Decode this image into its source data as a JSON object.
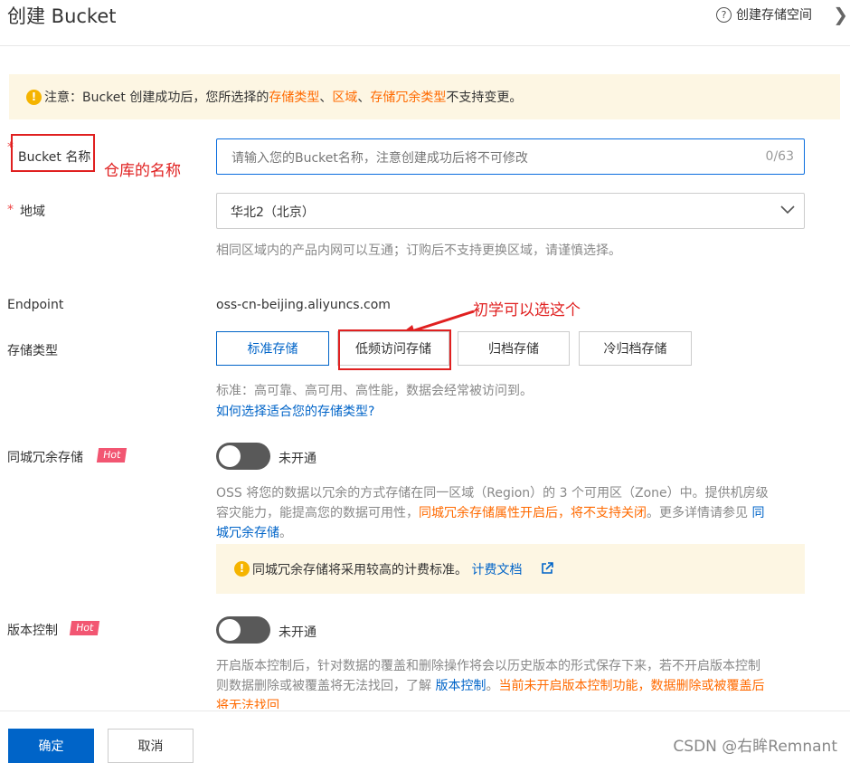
{
  "header": {
    "title": "创建 Bucket",
    "help_text": "创建存储空间"
  },
  "notice": {
    "prefix": "注意：Bucket 创建成功后，您所选择的 ",
    "link1": "存储类型",
    "sep1": "、",
    "link2": "区域",
    "sep2": "、",
    "link3": "存储冗余类型",
    "suffix": " 不支持变更。"
  },
  "bucket_name": {
    "label": "Bucket 名称",
    "placeholder": "请输入您的Bucket名称，注意创建成功后将不可修改",
    "counter": "0/63",
    "annotation": "仓库的名称"
  },
  "region": {
    "label": "地域",
    "value": "华北2（北京）",
    "hint": "相同区域内的产品内网可以互通；订购后不支持更换区域，请谨慎选择。"
  },
  "endpoint": {
    "label": "Endpoint",
    "value": "oss-cn-beijing.aliyuncs.com"
  },
  "storage_type": {
    "label": "存储类型",
    "annotation": "初学可以选这个",
    "options": [
      "标准存储",
      "低频访问存储",
      "归档存储",
      "冷归档存储"
    ],
    "selected": "标准存储",
    "desc": "标准：高可靠、高可用、高性能，数据会经常被访问到。",
    "link": "如何选择适合您的存储类型?"
  },
  "zone_redundancy": {
    "label": "同城冗余存储",
    "badge": "Hot",
    "toggle_label": "未开通",
    "desc_line1": "OSS 将您的数据以冗余的方式存储在同一区域（Region）的 3 个可用区（Zone）中。提供机房级",
    "desc_line2_a": "容灾能力，能提高您的数据可用性，",
    "desc_line2_orange": "同城冗余存储属性开启后，将不支持关闭",
    "desc_line2_b": "。更多详情请参见 ",
    "desc_line2_link": "同",
    "desc_line3_link": "城冗余存储",
    "desc_line3_end": "。",
    "warn_text": "同城冗余存储将采用较高的计费标准。",
    "warn_link": "计费文档"
  },
  "versioning": {
    "label": "版本控制",
    "badge": "Hot",
    "toggle_label": "未开通",
    "desc_line1": "开启版本控制后，针对数据的覆盖和删除操作将会以历史版本的形式保存下来，若不开启版本控制",
    "desc_line2_a": "则数据删除或被覆盖将无法找回，了解 ",
    "desc_line2_link": "版本控制",
    "desc_line2_b": "。",
    "desc_line2_orange": "当前未开启版本控制功能，数据删除或被覆盖后",
    "desc_line3_orange": "将无法找回"
  },
  "footer": {
    "confirm": "确定",
    "cancel": "取消"
  },
  "watermark": "CSDN @右眸Remnant",
  "colors": {
    "primary": "#0064c8",
    "warning": "#ff6a00",
    "annotation": "#e02020",
    "hot": "#f25672"
  }
}
